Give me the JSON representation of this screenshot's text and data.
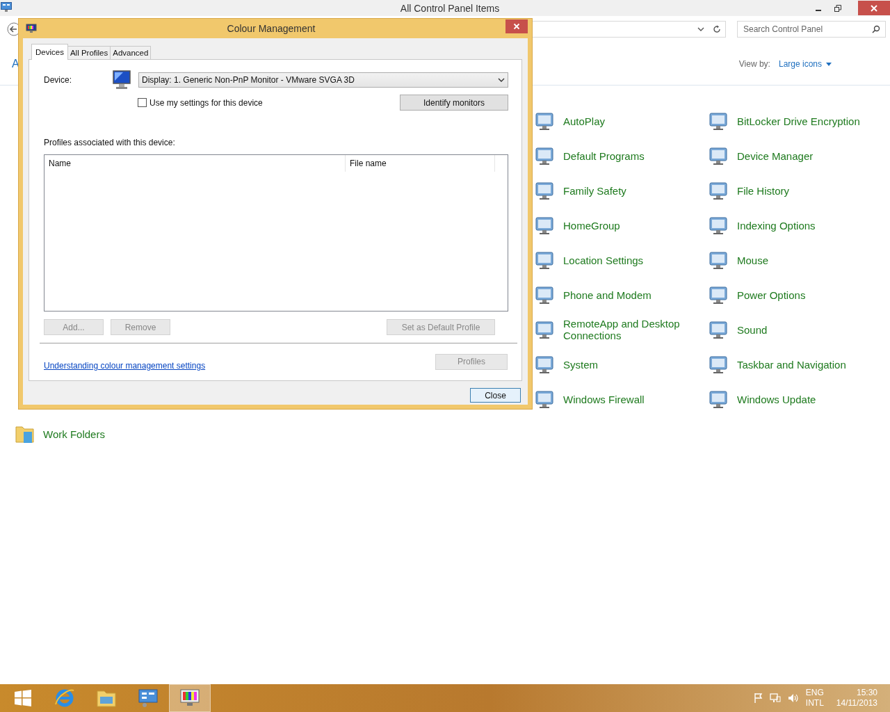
{
  "window": {
    "title": "All Control Panel Items",
    "search": {
      "placeholder": "Search Control Panel"
    },
    "heading_fragment": "A",
    "view_by": {
      "label": "View by:",
      "value": "Large icons"
    }
  },
  "items": [
    {
      "label": "AutoPlay"
    },
    {
      "label": "BitLocker Drive Encryption"
    },
    {
      "label": "Default Programs"
    },
    {
      "label": "Device Manager"
    },
    {
      "label": "Family Safety"
    },
    {
      "label": "File History"
    },
    {
      "label": "HomeGroup"
    },
    {
      "label": "Indexing Options"
    },
    {
      "label": "Location Settings"
    },
    {
      "label": "Mouse"
    },
    {
      "label": "Phone and Modem"
    },
    {
      "label": "Power Options"
    },
    {
      "label": "RemoteApp and Desktop Connections"
    },
    {
      "label": "Sound"
    },
    {
      "label": "System"
    },
    {
      "label": "Taskbar and Navigation"
    },
    {
      "label": "Windows Firewall"
    },
    {
      "label": "Windows Update"
    }
  ],
  "last_row_items": [
    {
      "label": "Work Folders"
    }
  ],
  "dialog": {
    "title": "Colour Management",
    "tabs": [
      {
        "label": "Devices",
        "selected": true
      },
      {
        "label": "All Profiles",
        "selected": false
      },
      {
        "label": "Advanced",
        "selected": false
      }
    ],
    "device_label": "Device:",
    "device_value": "Display: 1. Generic Non-PnP Monitor - VMware SVGA 3D",
    "use_my_settings": {
      "label": "Use my settings for this device",
      "checked": false
    },
    "identify_button": "Identify monitors",
    "profiles_label": "Profiles associated with this device:",
    "columns": [
      "Name",
      "File name"
    ],
    "list_buttons": [
      {
        "label": "Add...",
        "disabled": true
      },
      {
        "label": "Remove",
        "disabled": true
      },
      {
        "label": "Set as Default Profile",
        "disabled": true
      }
    ],
    "link": "Understanding colour management settings",
    "profiles_button": {
      "label": "Profiles",
      "disabled": true
    },
    "close_button": "Close"
  },
  "taskbar": {
    "apps": [
      {
        "kind": "start",
        "selected": false
      },
      {
        "kind": "browser",
        "selected": false
      },
      {
        "kind": "folder",
        "selected": false
      },
      {
        "kind": "controlpanel",
        "selected": false
      },
      {
        "kind": "monitor",
        "selected": true
      }
    ],
    "language": "ENG",
    "layout": "INTL",
    "time": "15:30",
    "date": "14/11/2013"
  }
}
